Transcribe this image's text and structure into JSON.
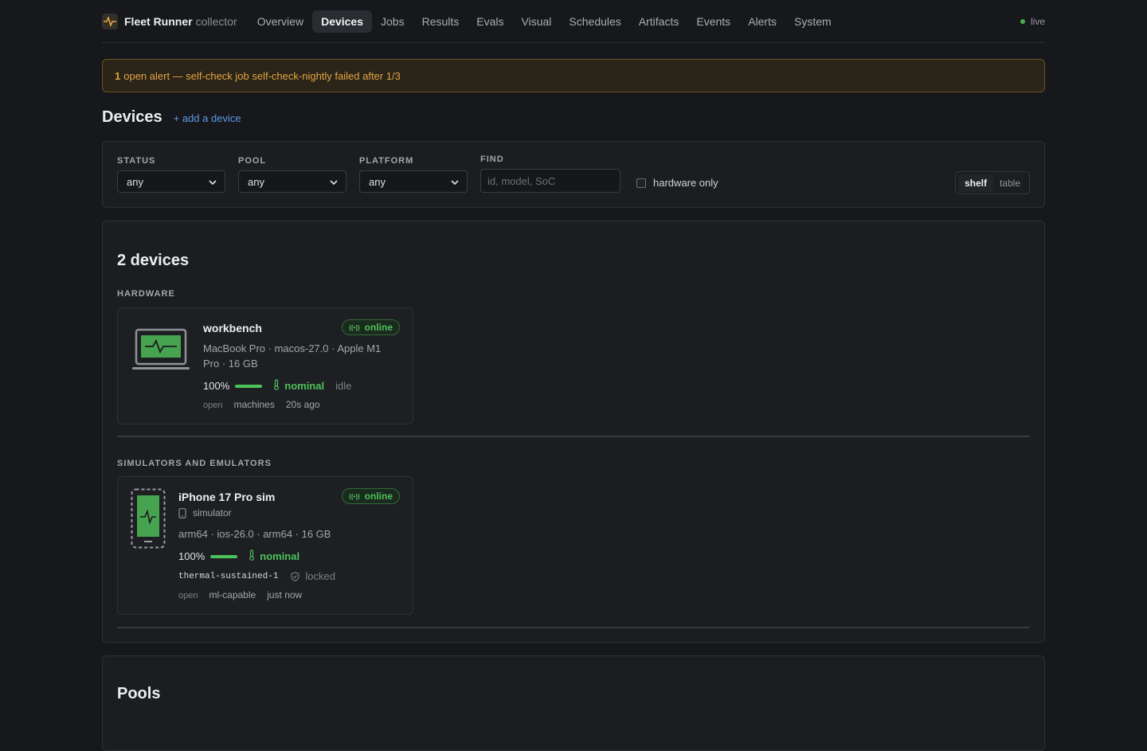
{
  "brand": {
    "name": "Fleet Runner",
    "sub": "collector"
  },
  "nav": [
    {
      "label": "Overview",
      "active": false
    },
    {
      "label": "Devices",
      "active": true
    },
    {
      "label": "Jobs",
      "active": false
    },
    {
      "label": "Results",
      "active": false
    },
    {
      "label": "Evals",
      "active": false
    },
    {
      "label": "Visual",
      "active": false
    },
    {
      "label": "Schedules",
      "active": false
    },
    {
      "label": "Artifacts",
      "active": false
    },
    {
      "label": "Events",
      "active": false
    },
    {
      "label": "Alerts",
      "active": false
    },
    {
      "label": "System",
      "active": false
    }
  ],
  "live_label": "live",
  "alert": {
    "count": "1",
    "text": "open alert — self-check job self-check-nightly failed after 1/3"
  },
  "page": {
    "title": "Devices",
    "add_link": "+ add a device"
  },
  "filters": {
    "status": {
      "label": "STATUS",
      "value": "any"
    },
    "pool": {
      "label": "POOL",
      "value": "any"
    },
    "platform": {
      "label": "PLATFORM",
      "value": "any"
    },
    "find": {
      "label": "FIND",
      "placeholder": "id, model, SoC",
      "value": ""
    },
    "hardware_only": {
      "label": "hardware only",
      "checked": false
    },
    "view_toggle": {
      "shelf": "shelf",
      "table": "table",
      "selected": "shelf"
    }
  },
  "devices": {
    "count_title": "2 devices",
    "hardware_label": "HARDWARE",
    "sim_label": "SIMULATORS AND EMULATORS",
    "workbench": {
      "name": "workbench",
      "status": "online",
      "meta_line1": "MacBook Pro · macos-27.0 · Apple M1",
      "meta_line2": "Pro · 16 GB",
      "battery": "100%",
      "battery_level": 1.0,
      "thermal": "nominal",
      "state": "idle",
      "access": "open",
      "pool": "machines",
      "seen": "20s ago"
    },
    "iphone": {
      "name": "iPhone 17 Pro sim",
      "kind": "simulator",
      "status": "online",
      "meta": "arm64 · ios-26.0 · arm64 · 16 GB",
      "battery": "100%",
      "battery_level": 1.0,
      "thermal": "nominal",
      "job": "thermal-sustained-1",
      "lock": "locked",
      "access": "open",
      "pool": "ml-capable",
      "seen": "just now"
    }
  },
  "pools_title": "Pools",
  "colors": {
    "accent_green": "#4cc25a",
    "alert_amber": "#e3a440",
    "link_blue": "#5b9be8"
  }
}
